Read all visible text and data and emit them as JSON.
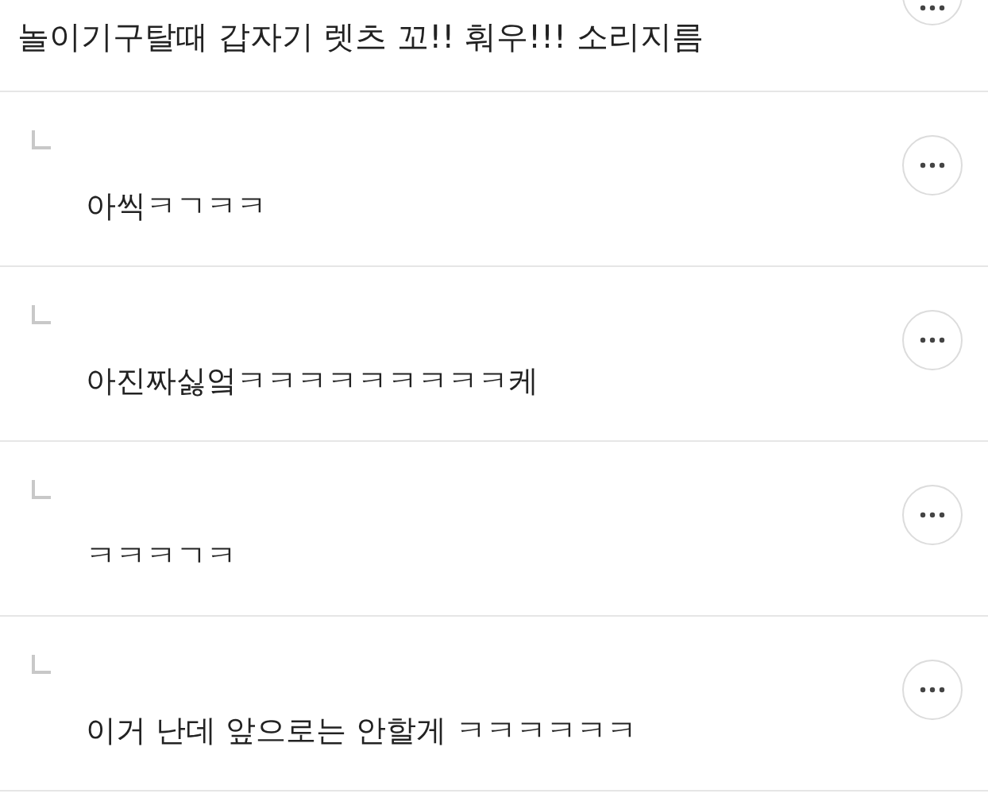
{
  "comment": {
    "text": "놀이기구탈때 갑자기 렛츠 꼬!! 훠우!!! 소리지름"
  },
  "replies": [
    {
      "text": "아씩ㅋㄱㅋㅋ"
    },
    {
      "text": "아진짜싫엌ㅋㅋㅋㅋㅋㅋㅋㅋㅋ케"
    },
    {
      "text": "ㅋㅋㅋㄱㅋ"
    },
    {
      "text": "이거 난데 앞으로는 안할게 ㅋㅋㅋㅋㅋㅋ"
    }
  ]
}
